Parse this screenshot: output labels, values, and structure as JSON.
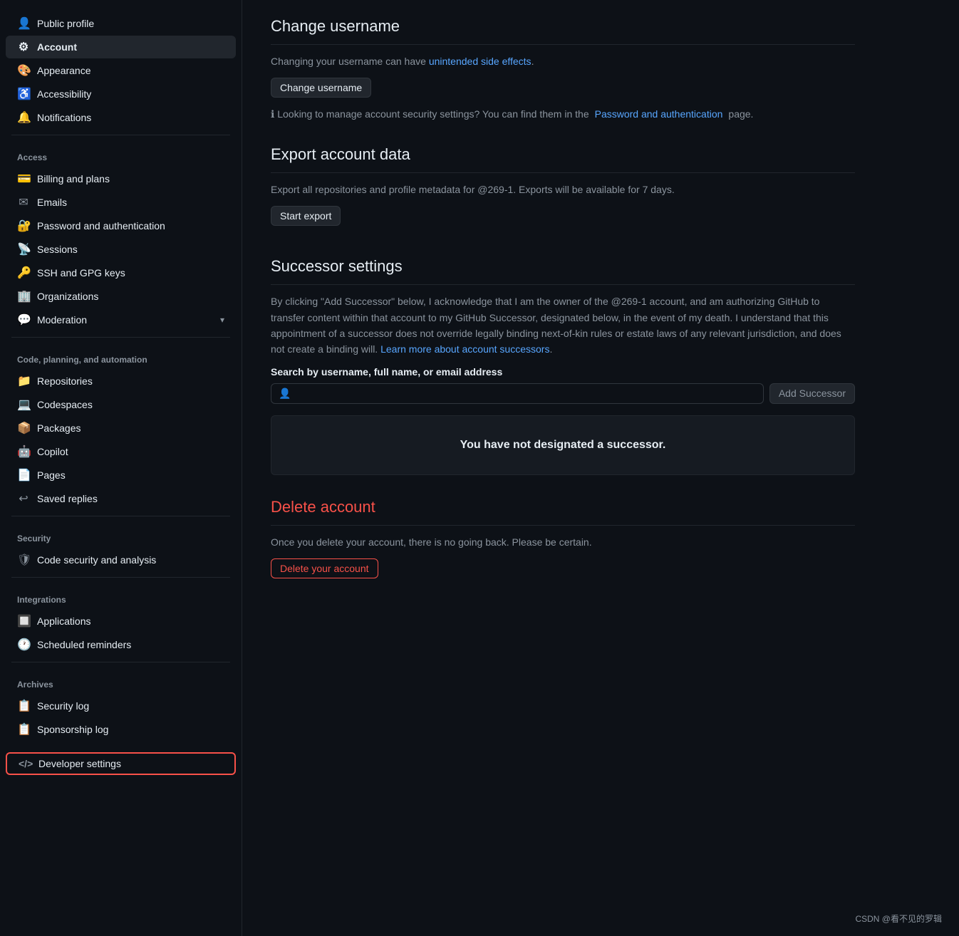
{
  "sidebar": {
    "top_items": [
      {
        "id": "public-profile",
        "label": "Public profile",
        "icon": "👤"
      },
      {
        "id": "account",
        "label": "Account",
        "icon": "⚙",
        "active": true
      },
      {
        "id": "appearance",
        "label": "Appearance",
        "icon": "🎨"
      },
      {
        "id": "accessibility",
        "label": "Accessibility",
        "icon": "♿"
      },
      {
        "id": "notifications",
        "label": "Notifications",
        "icon": "🔔"
      }
    ],
    "access_group": "Access",
    "access_items": [
      {
        "id": "billing",
        "label": "Billing and plans",
        "icon": "💳"
      },
      {
        "id": "emails",
        "label": "Emails",
        "icon": "✉"
      },
      {
        "id": "password",
        "label": "Password and authentication",
        "icon": "🔐"
      },
      {
        "id": "sessions",
        "label": "Sessions",
        "icon": "📡"
      },
      {
        "id": "ssh-gpg",
        "label": "SSH and GPG keys",
        "icon": "🔑"
      },
      {
        "id": "organizations",
        "label": "Organizations",
        "icon": "🏢"
      },
      {
        "id": "moderation",
        "label": "Moderation",
        "icon": "💬",
        "chevron": true
      }
    ],
    "code_group": "Code, planning, and automation",
    "code_items": [
      {
        "id": "repositories",
        "label": "Repositories",
        "icon": "📁"
      },
      {
        "id": "codespaces",
        "label": "Codespaces",
        "icon": "💻"
      },
      {
        "id": "packages",
        "label": "Packages",
        "icon": "📦"
      },
      {
        "id": "copilot",
        "label": "Copilot",
        "icon": "🤖"
      },
      {
        "id": "pages",
        "label": "Pages",
        "icon": "📄"
      },
      {
        "id": "saved-replies",
        "label": "Saved replies",
        "icon": "↩"
      }
    ],
    "security_group": "Security",
    "security_items": [
      {
        "id": "code-security",
        "label": "Code security and analysis",
        "icon": "🛡"
      }
    ],
    "integrations_group": "Integrations",
    "integrations_items": [
      {
        "id": "applications",
        "label": "Applications",
        "icon": "🔲"
      },
      {
        "id": "scheduled-reminders",
        "label": "Scheduled reminders",
        "icon": "🕐"
      }
    ],
    "archives_group": "Archives",
    "archives_items": [
      {
        "id": "security-log",
        "label": "Security log",
        "icon": "📋"
      },
      {
        "id": "sponsorship-log",
        "label": "Sponsorship log",
        "icon": "📋"
      }
    ],
    "developer_settings": {
      "label": "Developer settings",
      "icon": "<>"
    }
  },
  "main": {
    "change_username": {
      "title": "Change username",
      "description_prefix": "Changing your username can have ",
      "description_link": "unintended side effects",
      "description_suffix": ".",
      "button_label": "Change username",
      "info_prefix": "ℹ Looking to manage account security settings? You can find them in the ",
      "info_link": "Password and authentication",
      "info_suffix": " page."
    },
    "export_account": {
      "title": "Export account data",
      "description": "Export all repositories and profile metadata for @269-1. Exports will be available for 7 days.",
      "button_label": "Start export"
    },
    "successor_settings": {
      "title": "Successor settings",
      "description": "By clicking \"Add Successor\" below, I acknowledge that I am the owner of the @269-1 account, and am authorizing GitHub to transfer content within that account to my GitHub Successor, designated below, in the event of my death. I understand that this appointment of a successor does not override legally binding next-of-kin rules or estate laws of any relevant jurisdiction, and does not create a binding will.",
      "learn_more_text": "Learn more about account successors",
      "search_label": "Search by username, full name, or email address",
      "search_placeholder": "",
      "add_button_label": "Add Successor",
      "no_successor_text": "You have not designated a successor."
    },
    "delete_account": {
      "title": "Delete account",
      "description": "Once you delete your account, there is no going back. Please be certain.",
      "button_label": "Delete your account"
    }
  },
  "watermark": "CSDN @看不见的罗辑"
}
